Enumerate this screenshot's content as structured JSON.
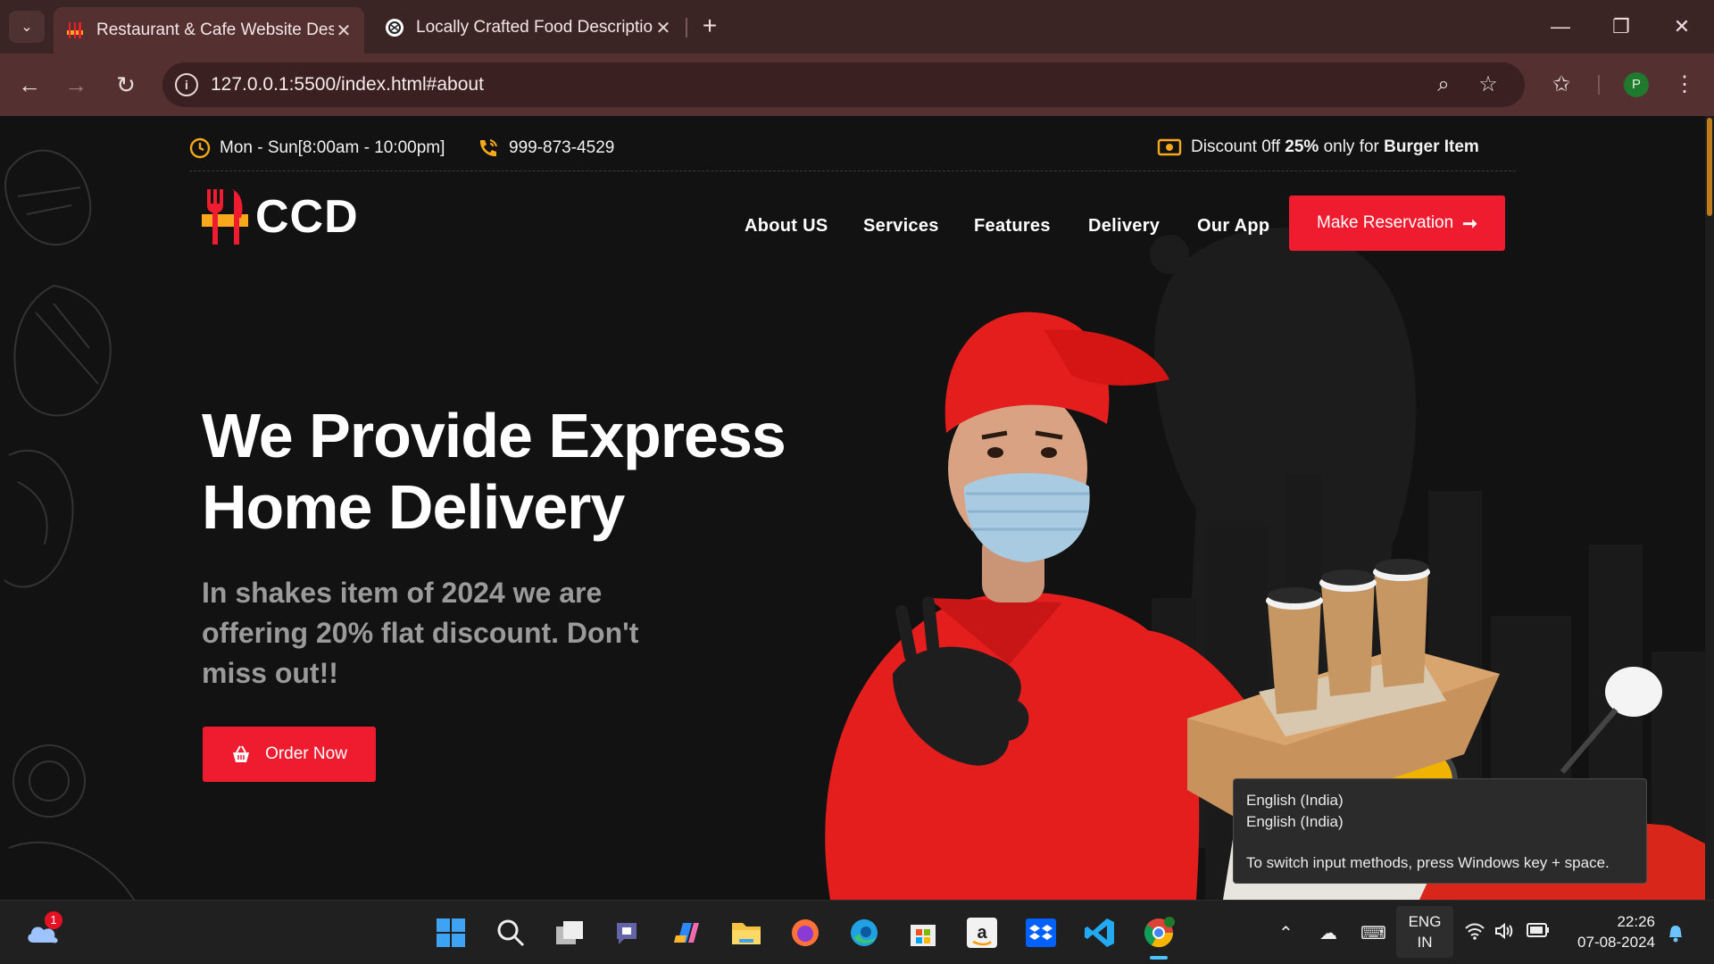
{
  "browser": {
    "tabs": [
      {
        "title": "Restaurant & Cafe Website Des",
        "active": true
      },
      {
        "title": "Locally Crafted Food Descriptio",
        "active": false
      }
    ],
    "url": "127.0.0.1:5500/index.html#about",
    "profile_initial": "P"
  },
  "site": {
    "topbar": {
      "hours": "Mon - Sun[8:00am - 10:00pm]",
      "phone": "999-873-4529",
      "discount_pre": "Discount 0ff ",
      "discount_pct": "25%",
      "discount_mid": " only for ",
      "discount_item": "Burger Item"
    },
    "logo": "CCD",
    "nav": [
      "About US",
      "Services",
      "Features",
      "Delivery",
      "Our App"
    ],
    "reserve_label": "Make Reservation",
    "hero": {
      "title_line1": "We Provide Express",
      "title_line2": "Home Delivery",
      "subtitle": "In shakes item of 2024 we are offering 20% flat discount. Don't miss out!!",
      "order_label": "Order Now"
    }
  },
  "tooltip": {
    "line1": "English (India)",
    "line2": "English (India)",
    "line3": "To switch input methods, press Windows key + space."
  },
  "taskbar": {
    "weather_badge": "1",
    "lang_line1": "ENG",
    "lang_line2": "IN",
    "time": "22:26",
    "date": "07-08-2024"
  },
  "colors": {
    "accent_red": "#ee1c2e",
    "accent_orange": "#f7a81b",
    "tab_bar": "#3b2424",
    "toolbar": "#553030"
  }
}
